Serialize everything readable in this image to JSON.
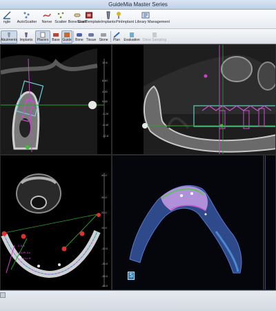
{
  "window": {
    "title": "GuideMia Master Series"
  },
  "toolbar_top": [
    {
      "label": "ngle",
      "icon": "angle-icon"
    },
    {
      "label": "AutoScatter",
      "icon": "auto-scatter-icon"
    },
    {
      "label": "Nerve",
      "icon": "nerve-icon"
    },
    {
      "label": "Scatter",
      "icon": "scatter-icon"
    },
    {
      "label": "Bone Graft",
      "icon": "bone-graft-icon"
    },
    {
      "label": "ScanTemplate",
      "icon": "scan-template-icon"
    },
    {
      "label": "Implants",
      "icon": "implants-icon"
    },
    {
      "label": "Pin",
      "icon": "pin-icon"
    },
    {
      "label": "Implant Library Management",
      "icon": "implant-library-icon"
    }
  ],
  "toolbar_modes": [
    {
      "label": "Abutments",
      "icon": "abutment-icon",
      "active": true
    },
    {
      "label": "Implants",
      "icon": "implant-icon",
      "active": false
    },
    {
      "label": "Placers",
      "icon": "placer-icon",
      "active": true
    },
    {
      "label": "Base",
      "icon": "base-icon",
      "active": false
    },
    {
      "label": "Guide",
      "icon": "guide-icon",
      "active": true
    },
    {
      "label": "Bone",
      "icon": "bone-icon",
      "active": false
    },
    {
      "label": "Tissue",
      "icon": "tissue-icon",
      "active": false
    },
    {
      "label": "Stone",
      "icon": "stone-icon",
      "active": false
    },
    {
      "label": "Plan",
      "icon": "plan-icon",
      "active": false
    },
    {
      "label": "Evaluation",
      "icon": "evaluation-icon",
      "active": false
    },
    {
      "label": "Done Sampling",
      "icon": "done-sampling-icon",
      "active": false,
      "disabled": true
    }
  ],
  "views": {
    "cross_section": {
      "ruler": [
        "12.6",
        "8.40",
        "4.20",
        "0.00",
        "-4.20",
        "-8.40",
        "-12.6"
      ]
    },
    "axial": {
      "ruler": [
        "40.0",
        "30.0",
        "20.0",
        "10.0",
        "-10.0",
        "-20.0",
        "-30.0",
        "-40.0"
      ]
    },
    "axial_labels": [
      "C 0.5",
      "C 0.5 Pt 3 c",
      "1 Lc H"
    ],
    "render3d": {
      "badge": "S"
    }
  }
}
